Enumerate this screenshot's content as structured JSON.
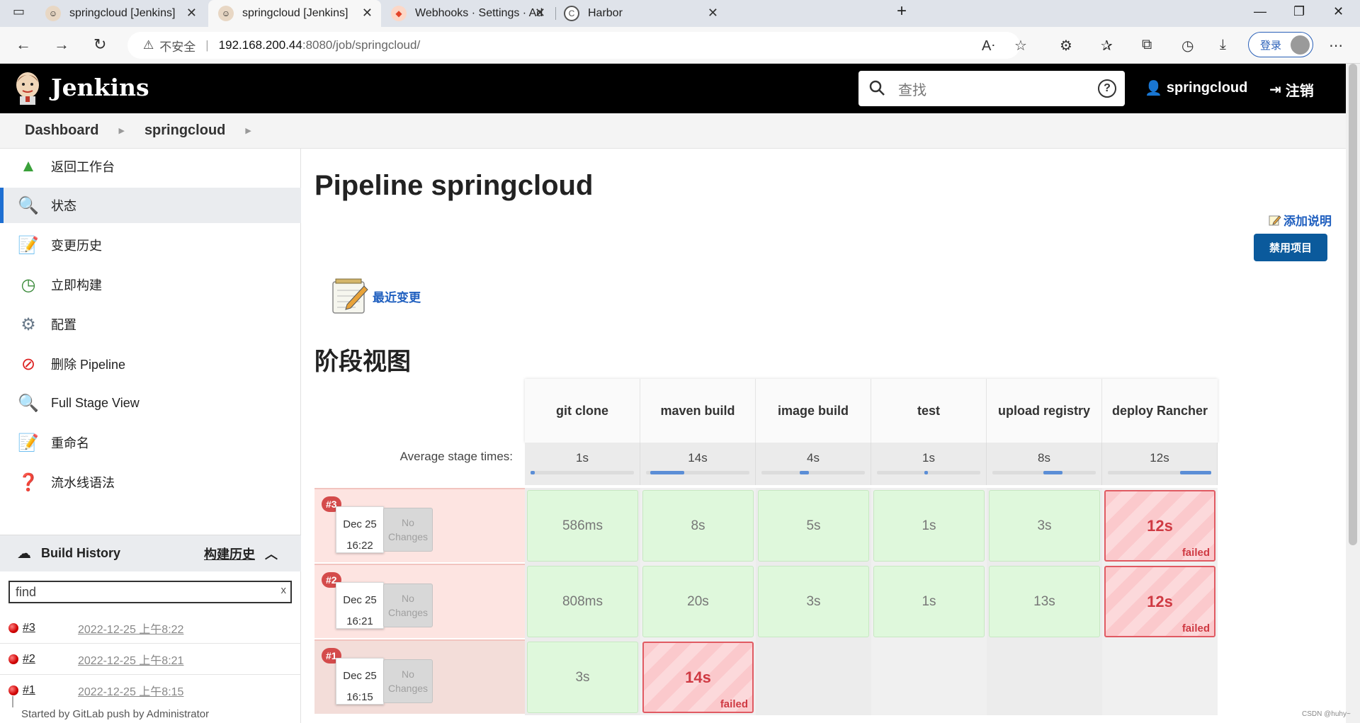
{
  "browser": {
    "tabs": [
      {
        "title": "springcloud [Jenkins]",
        "active": false
      },
      {
        "title": "springcloud [Jenkins]",
        "active": true
      },
      {
        "title": "Webhooks · Settings · Administra",
        "active": false
      },
      {
        "title": "Harbor",
        "active": false
      }
    ],
    "url_warning": "不安全",
    "url_host": "192.168.200.44",
    "url_path": ":8080/job/springcloud/",
    "login_label": "登录"
  },
  "header": {
    "app_name": "Jenkins",
    "search_placeholder": "查找",
    "user": "springcloud",
    "logout": "注销"
  },
  "breadcrumb": [
    "Dashboard",
    "springcloud"
  ],
  "sidebar": {
    "items": [
      {
        "label": "返回工作台",
        "icon": "up-arrow-icon"
      },
      {
        "label": "状态",
        "icon": "magnifier-icon",
        "active": true
      },
      {
        "label": "变更历史",
        "icon": "notepad-icon"
      },
      {
        "label": "立即构建",
        "icon": "clock-build-icon"
      },
      {
        "label": "配置",
        "icon": "gear-icon"
      },
      {
        "label": "删除 Pipeline",
        "icon": "no-entry-icon"
      },
      {
        "label": "Full Stage View",
        "icon": "magnifier-icon"
      },
      {
        "label": "重命名",
        "icon": "notepad-icon"
      },
      {
        "label": "流水线语法",
        "icon": "help-icon"
      }
    ]
  },
  "build_history": {
    "title": "Build History",
    "trend_link": "构建历史",
    "find_value": "find",
    "clear": "x",
    "builds": [
      {
        "num": "#3",
        "date": "2022-12-25 上午8:22"
      },
      {
        "num": "#2",
        "date": "2022-12-25 上午8:21"
      },
      {
        "num": "#1",
        "date": "2022-12-25 上午8:15"
      }
    ],
    "started_by": "Started by GitLab push by Administrator"
  },
  "main": {
    "title": "Pipeline springcloud",
    "add_description": "添加说明",
    "disable_button": "禁用项目",
    "recent_changes": "最近变更",
    "stage_view_title": "阶段视图"
  },
  "stage_view": {
    "avg_label": "Average stage times:",
    "stages": [
      {
        "name": "git clone",
        "avg": "1s",
        "bar_start": 0.0,
        "bar_len": 0.04
      },
      {
        "name": "maven build",
        "avg": "14s",
        "bar_start": 0.04,
        "bar_len": 0.33
      },
      {
        "name": "image build",
        "avg": "4s",
        "bar_start": 0.37,
        "bar_len": 0.09
      },
      {
        "name": "test",
        "avg": "1s",
        "bar_start": 0.46,
        "bar_len": 0.03
      },
      {
        "name": "upload registry",
        "avg": "8s",
        "bar_start": 0.49,
        "bar_len": 0.19
      },
      {
        "name": "deploy Rancher",
        "avg": "12s",
        "bar_start": 0.7,
        "bar_len": 0.3
      }
    ],
    "runs": [
      {
        "badge": "#3",
        "date": "Dec 25",
        "time": "16:22",
        "changes": "No Changes",
        "cells": [
          {
            "value": "586ms",
            "status": "ok"
          },
          {
            "value": "8s",
            "status": "ok"
          },
          {
            "value": "5s",
            "status": "ok"
          },
          {
            "value": "1s",
            "status": "ok"
          },
          {
            "value": "3s",
            "status": "ok"
          },
          {
            "value": "12s",
            "status": "failed"
          }
        ]
      },
      {
        "badge": "#2",
        "date": "Dec 25",
        "time": "16:21",
        "changes": "No Changes",
        "cells": [
          {
            "value": "808ms",
            "status": "ok"
          },
          {
            "value": "20s",
            "status": "ok"
          },
          {
            "value": "3s",
            "status": "ok"
          },
          {
            "value": "1s",
            "status": "ok"
          },
          {
            "value": "13s",
            "status": "ok"
          },
          {
            "value": "12s",
            "status": "failed"
          }
        ]
      },
      {
        "badge": "#1",
        "date": "Dec 25",
        "time": "16:15",
        "changes": "No Changes",
        "cells": [
          {
            "value": "3s",
            "status": "ok"
          },
          {
            "value": "14s",
            "status": "failed"
          },
          {
            "value": "",
            "status": "empty"
          },
          {
            "value": "",
            "status": "empty"
          },
          {
            "value": "",
            "status": "empty"
          },
          {
            "value": "",
            "status": "empty"
          }
        ]
      }
    ],
    "failed_label": "failed"
  },
  "watermark": "CSDN @huhy~",
  "colors": {
    "accent": "#1e6fd2",
    "link": "#1f5fbf",
    "success_cell": "#dff8dc",
    "failed_cell": "#fbc9cc",
    "failed_text": "#cf3a43",
    "run_row_red": "#fde4e1"
  }
}
